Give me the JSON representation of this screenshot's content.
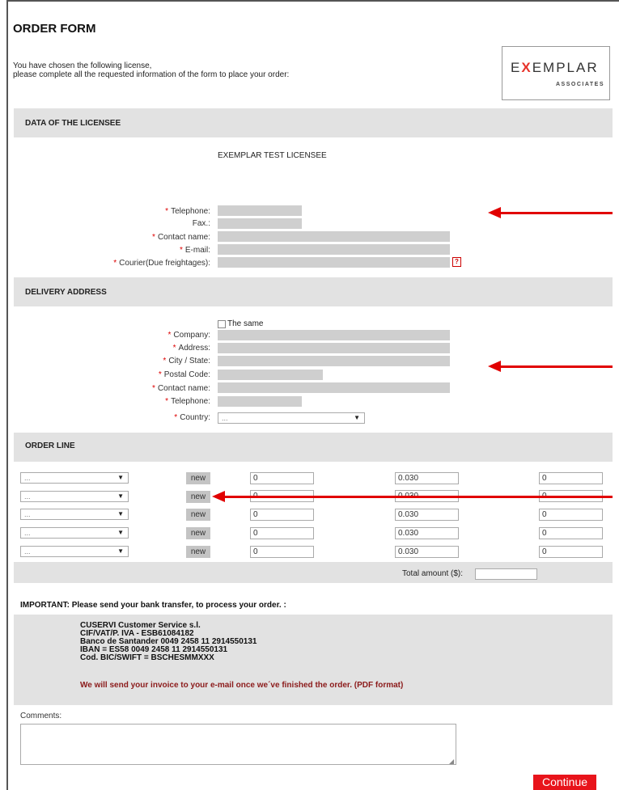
{
  "header": {
    "title": "ORDER FORM",
    "intro_line1": "You have chosen the following license,",
    "intro_line2": "please complete all the requested information of the form to place your order:",
    "logo_text": "EXEMPLAR",
    "logo_sub": "ASSOCIATES"
  },
  "licensee": {
    "section_title": "DATA OF THE LICENSEE",
    "name": "EXEMPLAR TEST LICENSEE",
    "fields": {
      "telephone": "Telephone:",
      "fax": "Fax.:",
      "contact_name": "Contact name:",
      "email": "E-mail:",
      "courier": "Courier(Due freightages):"
    },
    "required_mark": "*",
    "help_icon": "?"
  },
  "delivery": {
    "section_title": "DELIVERY ADDRESS",
    "same_label": "The same",
    "fields": {
      "company": "Company:",
      "address": "Address:",
      "city_state": "City / State:",
      "postal_code": "Postal Code:",
      "contact_name": "Contact name:",
      "telephone": "Telephone:",
      "country": "Country:"
    },
    "country_value": "..."
  },
  "order_line": {
    "section_title": "ORDER LINE",
    "rows": [
      {
        "product": "...",
        "new_label": "new",
        "qty": "0",
        "price": "0.030",
        "total": "0"
      },
      {
        "product": "...",
        "new_label": "new",
        "qty": "0",
        "price": "0.030",
        "total": "0"
      },
      {
        "product": "...",
        "new_label": "new",
        "qty": "0",
        "price": "0.030",
        "total": "0"
      },
      {
        "product": "...",
        "new_label": "new",
        "qty": "0",
        "price": "0.030",
        "total": "0"
      },
      {
        "product": "...",
        "new_label": "new",
        "qty": "0",
        "price": "0.030",
        "total": "0"
      }
    ],
    "total_label": "Total amount ($):",
    "total_value": ""
  },
  "bank": {
    "important": "IMPORTANT: Please send your bank transfer, to process your order. :",
    "lines": [
      "CUSERVI Customer Service s.l.",
      "CIF/VAT/P. IVA - ESB61084182",
      "Banco de Santander 0049 2458 11 2914550131",
      "IBAN = ES58 0049 2458 11 2914550131",
      "Cod. BIC/SWIFT = BSCHESMMXXX"
    ],
    "note": "We will send your invoice to your e-mail once we´ve finished the order. (PDF format)"
  },
  "comments": {
    "label": "Comments:",
    "value": ""
  },
  "continue_label": "Continue",
  "colors": {
    "accent_red": "#e8141b",
    "band_grey": "#e2e2e2",
    "field_grey": "#cfcfcf",
    "note_red": "#8b1a1a"
  }
}
